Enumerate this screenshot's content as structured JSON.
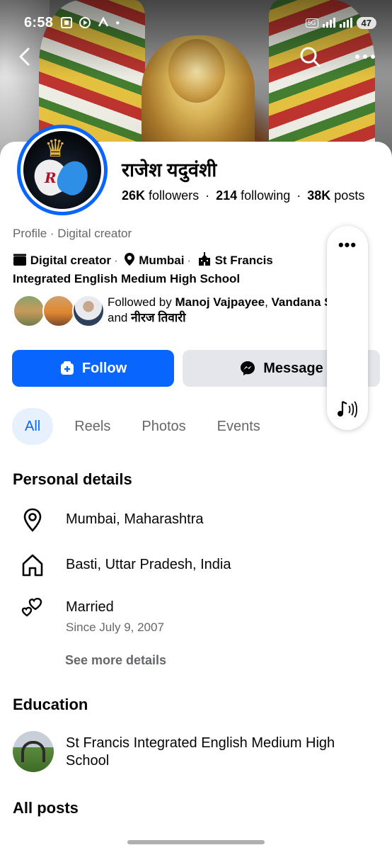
{
  "status_bar": {
    "time": "6:58",
    "network": "5G",
    "battery": "47"
  },
  "profile": {
    "name": "राजेश यदुवंशी",
    "followers_count": "26K",
    "followers_label": "followers",
    "following_count": "214",
    "following_label": "following",
    "posts_count": "38K",
    "posts_label": "posts",
    "category_line": "Profile · Digital creator"
  },
  "intro": {
    "role": "Digital creator",
    "city": "Mumbai",
    "school": "St Francis Integrated English Medium High School"
  },
  "followed_by": {
    "prefix": "Followed by",
    "name1": "Manoj Vajpayee",
    "name2": "Vandana Shekhar",
    "conjunction": "and",
    "name3": "नीरज तिवारी"
  },
  "actions": {
    "follow_label": "Follow",
    "message_label": "Message"
  },
  "tabs": [
    {
      "label": "All"
    },
    {
      "label": "Reels"
    },
    {
      "label": "Photos"
    },
    {
      "label": "Events"
    }
  ],
  "personal_details": {
    "title": "Personal details",
    "current_city": "Mumbai, Maharashtra",
    "hometown": "Basti, Uttar Pradesh, India",
    "relationship": "Married",
    "relationship_since": "Since July 9, 2007",
    "see_more": "See more details"
  },
  "education": {
    "title": "Education",
    "school": "St Francis Integrated English Medium High School"
  },
  "all_posts": {
    "title": "All posts"
  },
  "colors": {
    "accent": "#0866ff",
    "secondary_button": "#e4e6eb",
    "muted_text": "#65676b"
  }
}
